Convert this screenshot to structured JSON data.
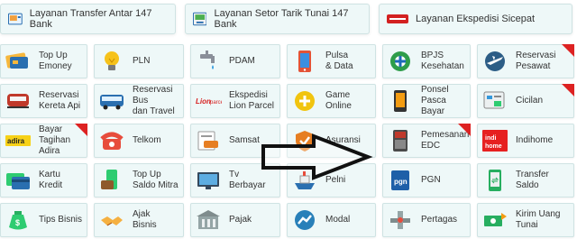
{
  "top_cards": [
    {
      "label": "Layanan Transfer Antar 147 Bank",
      "icon": "bank-transfer-icon"
    },
    {
      "label": "Layanan Setor Tarik Tunai 147 Bank",
      "icon": "cash-deposit-icon"
    },
    {
      "label": "Layanan Ekspedisi Sicepat",
      "icon": "sicepat-logo-icon"
    }
  ],
  "tiles": [
    {
      "label": "Top Up\nEmoney",
      "icon": "emoney-card-icon"
    },
    {
      "label": "PLN",
      "icon": "lightbulb-icon"
    },
    {
      "label": "PDAM",
      "icon": "water-tap-icon"
    },
    {
      "label": "Pulsa\n& Data",
      "icon": "phone-icon"
    },
    {
      "label": "BPJS\nKesehatan",
      "icon": "bpjs-icon"
    },
    {
      "label": "Reservasi\nPesawat",
      "icon": "airplane-icon"
    },
    {
      "label": "Reservasi\nKereta Api",
      "icon": "train-icon"
    },
    {
      "label": "Reservasi Bus\ndan Travel",
      "icon": "bus-icon"
    },
    {
      "label": "Ekspedisi\nLion Parcel",
      "icon": "lion-parcel-icon"
    },
    {
      "label": "Game\nOnline",
      "icon": "game-icon"
    },
    {
      "label": "Ponsel\nPasca Bayar",
      "icon": "smartphone-icon"
    },
    {
      "label": "Cicilan",
      "icon": "installment-icon"
    },
    {
      "label": "Bayar\nTagihan Adira",
      "icon": "adira-icon"
    },
    {
      "label": "Telkom",
      "icon": "telephone-icon"
    },
    {
      "label": "Samsat",
      "icon": "car-tax-icon"
    },
    {
      "label": "Asuransi",
      "icon": "insurance-icon"
    },
    {
      "label": "Pemesanan\nEDC",
      "icon": "edc-machine-icon"
    },
    {
      "label": "Indihome",
      "icon": "indihome-icon"
    },
    {
      "label": "Kartu\nKredit",
      "icon": "credit-card-icon"
    },
    {
      "label": "Top Up\nSaldo Mitra",
      "icon": "wallet-phone-icon"
    },
    {
      "label": "Tv\nBerbayar",
      "icon": "tv-icon"
    },
    {
      "label": "Pelni",
      "icon": "ship-icon"
    },
    {
      "label": "PGN",
      "icon": "pgn-icon"
    },
    {
      "label": "Transfer\nSaldo",
      "icon": "transfer-phone-icon"
    },
    {
      "label": "Tips Bisnis",
      "icon": "money-bag-icon"
    },
    {
      "label": "Ajak\nBisnis",
      "icon": "handshake-icon"
    },
    {
      "label": "Pajak",
      "icon": "tax-building-icon"
    },
    {
      "label": "Modal",
      "icon": "capital-icon"
    },
    {
      "label": "Pertagas",
      "icon": "gas-pipe-icon"
    },
    {
      "label": "Kirim Uang\nTunai",
      "icon": "send-cash-icon"
    }
  ],
  "new_badges": [
    5,
    11,
    12,
    16
  ],
  "colors": {
    "tile_bg": "#eef8f8",
    "tile_border": "#cfe3e3",
    "badge": "#dd2222",
    "arrow": "#111111"
  }
}
